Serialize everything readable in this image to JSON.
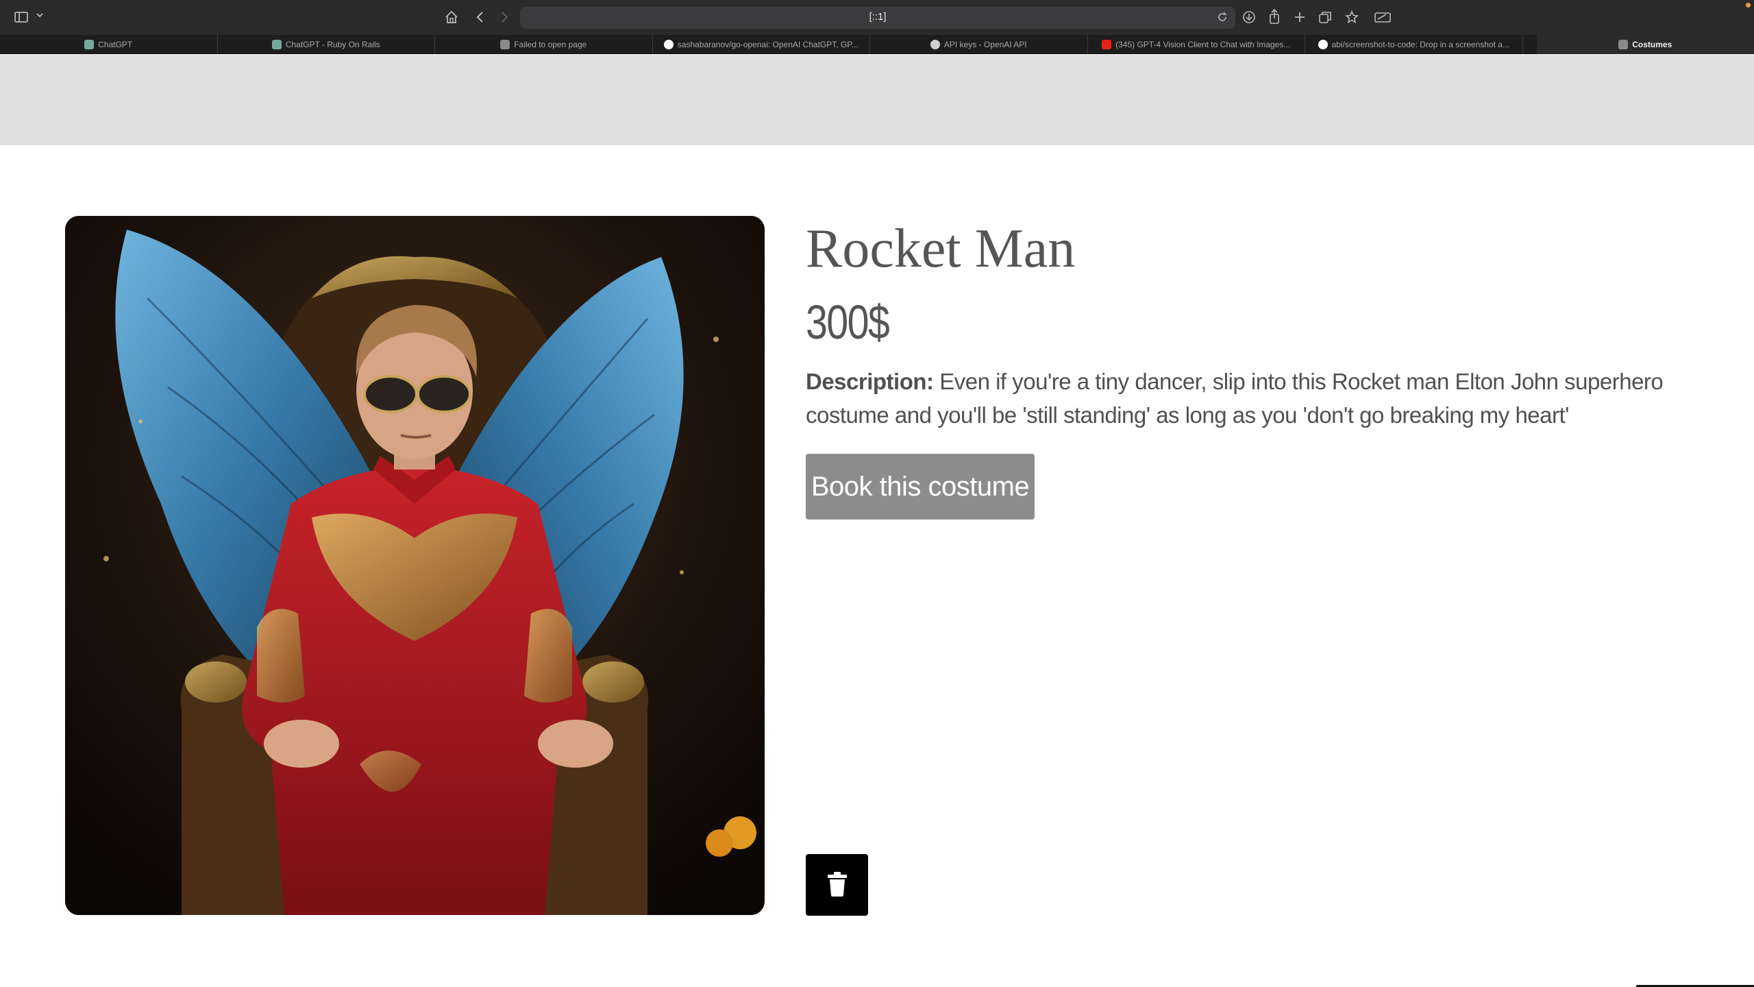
{
  "browser": {
    "address_text": "[::1]",
    "tabs": [
      {
        "label": "ChatGPT",
        "icon": "chatgpt-icon",
        "icon_color": "#74aa9c"
      },
      {
        "label": "ChatGPT - Ruby On Rails",
        "icon": "chatgpt-icon",
        "icon_color": "#74aa9c"
      },
      {
        "label": "Failed to open page",
        "icon": "page-icon",
        "icon_color": "#8a8a8d"
      },
      {
        "label": "sashabaranov/go-openai: OpenAI ChatGPT, GP...",
        "icon": "github-icon",
        "icon_color": "#ffffff"
      },
      {
        "label": "API keys - OpenAI API",
        "icon": "openai-icon",
        "icon_color": "#d0d0d0"
      },
      {
        "label": "(345) GPT-4 Vision Client to Chat with Images...",
        "icon": "youtube-icon",
        "icon_color": "#e62117"
      },
      {
        "label": "abi/screenshot-to-code: Drop in a screenshot a...",
        "icon": "github-icon",
        "icon_color": "#ffffff"
      },
      {
        "label": "Costumes",
        "icon": "page-icon",
        "icon_color": "#8a8a8d",
        "active": true
      }
    ]
  },
  "product": {
    "image_alt": "Man in red and gold sequined suit with blue feathered wings seated on an ornate throne",
    "title": "Rocket Man",
    "price": "300$",
    "description_label": "Description:",
    "description_text": "Even if you're a tiny dancer, slip into this Rocket man Elton John superhero costume and you'll be 'still standing' as long as you 'don't go breaking my heart'",
    "book_button_label": "Book this costume",
    "delete_icon": "trash-icon"
  },
  "colors": {
    "header_band": "#e0e0e0",
    "text": "#555555",
    "book_button_bg": "#8c8c8c",
    "delete_button_bg": "#000000"
  }
}
